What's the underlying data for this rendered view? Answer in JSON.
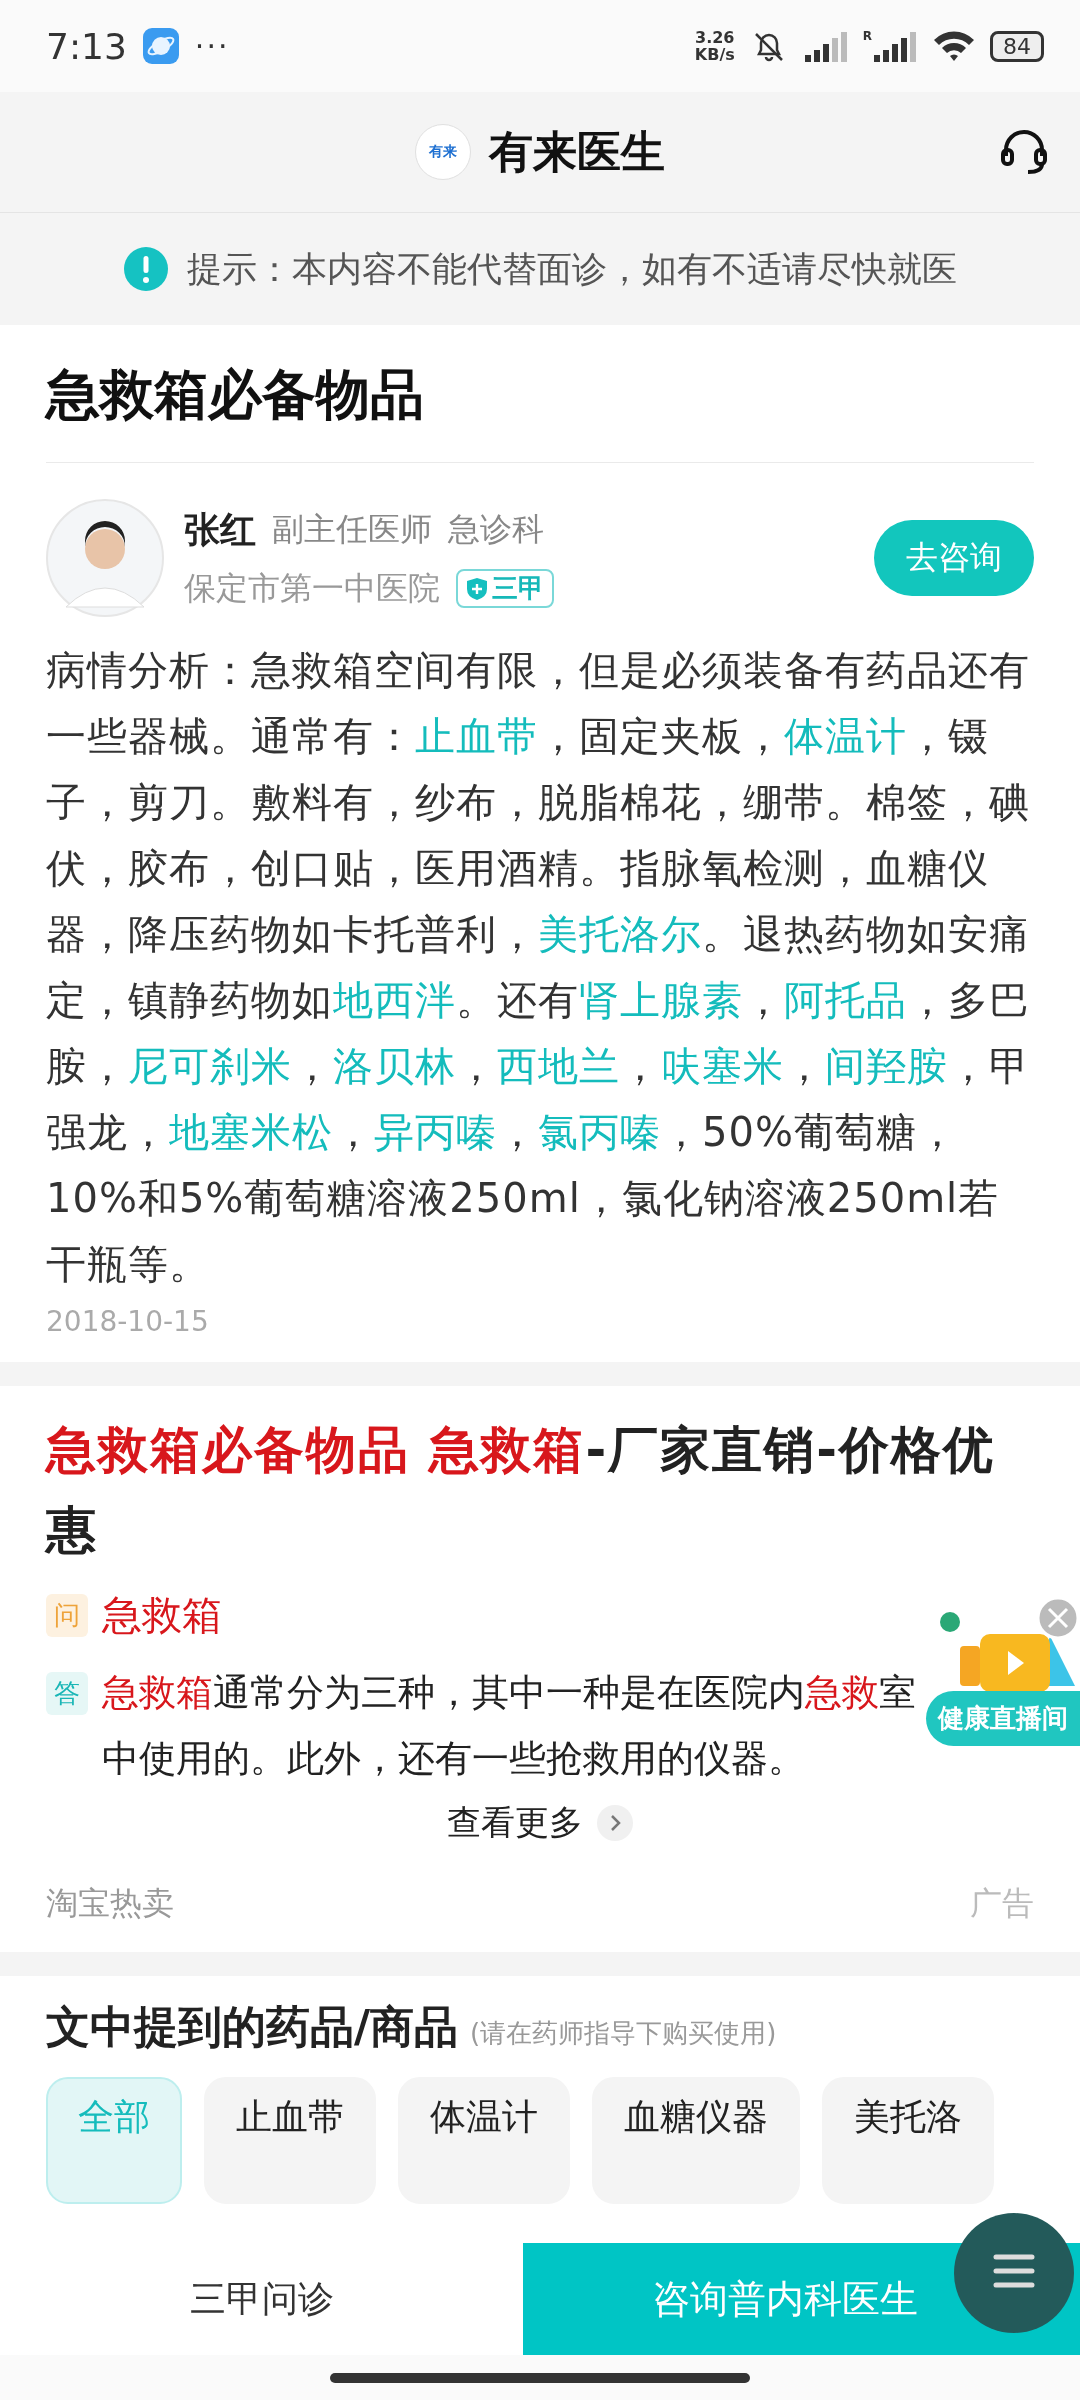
{
  "status_bar": {
    "time": "7:13",
    "more": "···",
    "net_speed": "3.26",
    "net_unit": "KB/s",
    "roaming": "R",
    "battery": "84"
  },
  "header": {
    "logo_text": "有来",
    "title": "有来医生"
  },
  "notice": {
    "text": "提示：本内容不能代替面诊，如有不适请尽快就医"
  },
  "article": {
    "title": "急救箱必备物品",
    "doctor": {
      "name": "张红",
      "title": "副主任医师",
      "department": "急诊科",
      "hospital": "保定市第一中医院",
      "badge": "三甲",
      "consult_button": "去咨询"
    },
    "analysis": [
      {
        "text": "病情分析：急救箱空间有限，但是必须装备有药品还有一些器械。通常有：",
        "kind": "text"
      },
      {
        "text": "止血带",
        "kind": "link"
      },
      {
        "text": "，固定夹板，",
        "kind": "text"
      },
      {
        "text": "体温计",
        "kind": "link"
      },
      {
        "text": "，镊子，剪刀。敷料有，纱布，脱脂棉花，绷带。棉签，碘伏，胶布，创口贴，医用酒精。指脉氧检测，血糖仪器，降压药物如卡托普利，",
        "kind": "text"
      },
      {
        "text": "美托洛尔",
        "kind": "link"
      },
      {
        "text": "。退热药物如安痛定，镇静药物如",
        "kind": "text"
      },
      {
        "text": "地西泮",
        "kind": "link"
      },
      {
        "text": "。还有",
        "kind": "text"
      },
      {
        "text": "肾上腺素",
        "kind": "link"
      },
      {
        "text": "，",
        "kind": "text"
      },
      {
        "text": "阿托品",
        "kind": "link"
      },
      {
        "text": "，多巴胺，",
        "kind": "text"
      },
      {
        "text": "尼可刹米",
        "kind": "link"
      },
      {
        "text": "，",
        "kind": "text"
      },
      {
        "text": "洛贝林",
        "kind": "link"
      },
      {
        "text": "，",
        "kind": "text"
      },
      {
        "text": "西地兰",
        "kind": "link"
      },
      {
        "text": "，",
        "kind": "text"
      },
      {
        "text": "呋塞米",
        "kind": "link"
      },
      {
        "text": "，",
        "kind": "text"
      },
      {
        "text": "间羟胺",
        "kind": "link"
      },
      {
        "text": "，甲强龙，",
        "kind": "text"
      },
      {
        "text": "地塞米松",
        "kind": "link"
      },
      {
        "text": "，",
        "kind": "text"
      },
      {
        "text": "异丙嗪",
        "kind": "link"
      },
      {
        "text": "，",
        "kind": "text"
      },
      {
        "text": "氯丙嗪",
        "kind": "link"
      },
      {
        "text": "，50%葡萄糖，10%和5%葡萄糖溶液250ml，氯化钠溶液250ml若干瓶等。",
        "kind": "text"
      }
    ],
    "date": "2018-10-15"
  },
  "ad": {
    "title": [
      {
        "text": "急救箱必备物品 急救箱",
        "highlight": true
      },
      {
        "text": "-厂家直销-价格优惠",
        "highlight": false
      }
    ],
    "question": {
      "tag": "问",
      "segments": [
        {
          "text": "急救箱",
          "highlight": true
        }
      ]
    },
    "answer": {
      "tag": "答",
      "segments": [
        {
          "text": "急救箱",
          "highlight": true
        },
        {
          "text": "通常分为三种，其中一种是在医院内",
          "highlight": false
        },
        {
          "text": "急救",
          "highlight": true
        },
        {
          "text": "室中使用的。此外，还有一些抢救用的仪器。",
          "highlight": false
        }
      ]
    },
    "more": "查看更多",
    "source": "淘宝热卖",
    "ad_label": "广告"
  },
  "live_widget": {
    "label": "健康直播间"
  },
  "products": {
    "title": "文中提到的药品/商品",
    "note": "(请在药师指导下购买使用)",
    "chips": [
      {
        "label": "全部",
        "selected": true
      },
      {
        "label": "止血带",
        "selected": false
      },
      {
        "label": "体温计",
        "selected": false
      },
      {
        "label": "血糖仪器",
        "selected": false
      },
      {
        "label": "美托洛",
        "selected": false
      }
    ]
  },
  "bottom_bar": {
    "left": "三甲问诊",
    "right": "咨询普内科医生"
  }
}
